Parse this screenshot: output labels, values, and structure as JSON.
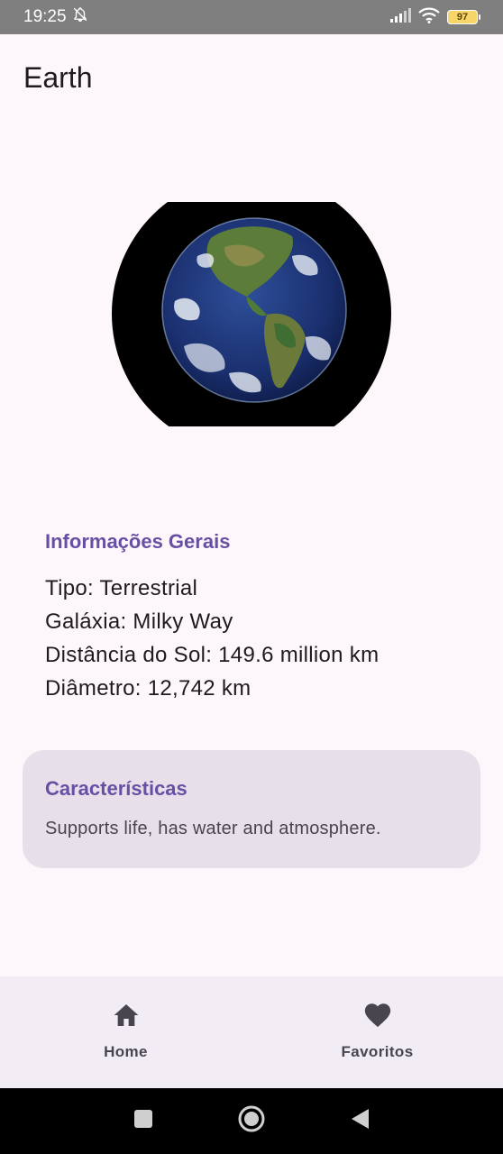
{
  "status_bar": {
    "time": "19:25",
    "battery": "97",
    "icons": [
      "bell-off-icon",
      "signal-icon",
      "wifi-icon",
      "battery-icon"
    ]
  },
  "app_bar": {
    "title": "Earth"
  },
  "planet": {
    "image": "earth-globe-image"
  },
  "info": {
    "title": "Informações Gerais",
    "tipo": "Tipo: Terrestrial",
    "galaxia": "Galáxia: Milky Way",
    "distancia": "Distância do Sol: 149.6 million km",
    "diametro": "Diâmetro: 12,742 km"
  },
  "characteristics": {
    "title": "Características",
    "text": "Supports life, has water and atmosphere."
  },
  "bottom_nav": {
    "items": [
      {
        "label": "Home",
        "icon": "home-icon"
      },
      {
        "label": "Favoritos",
        "icon": "heart-icon"
      }
    ]
  },
  "system_nav": {
    "icons": [
      "recents-icon",
      "home-circle-icon",
      "back-icon"
    ]
  },
  "colors": {
    "accent": "#6750a4",
    "background": "#fdf7fc",
    "card": "#e7e0eb",
    "nav": "#f2edf5",
    "status_bar": "#7f7f7f"
  }
}
